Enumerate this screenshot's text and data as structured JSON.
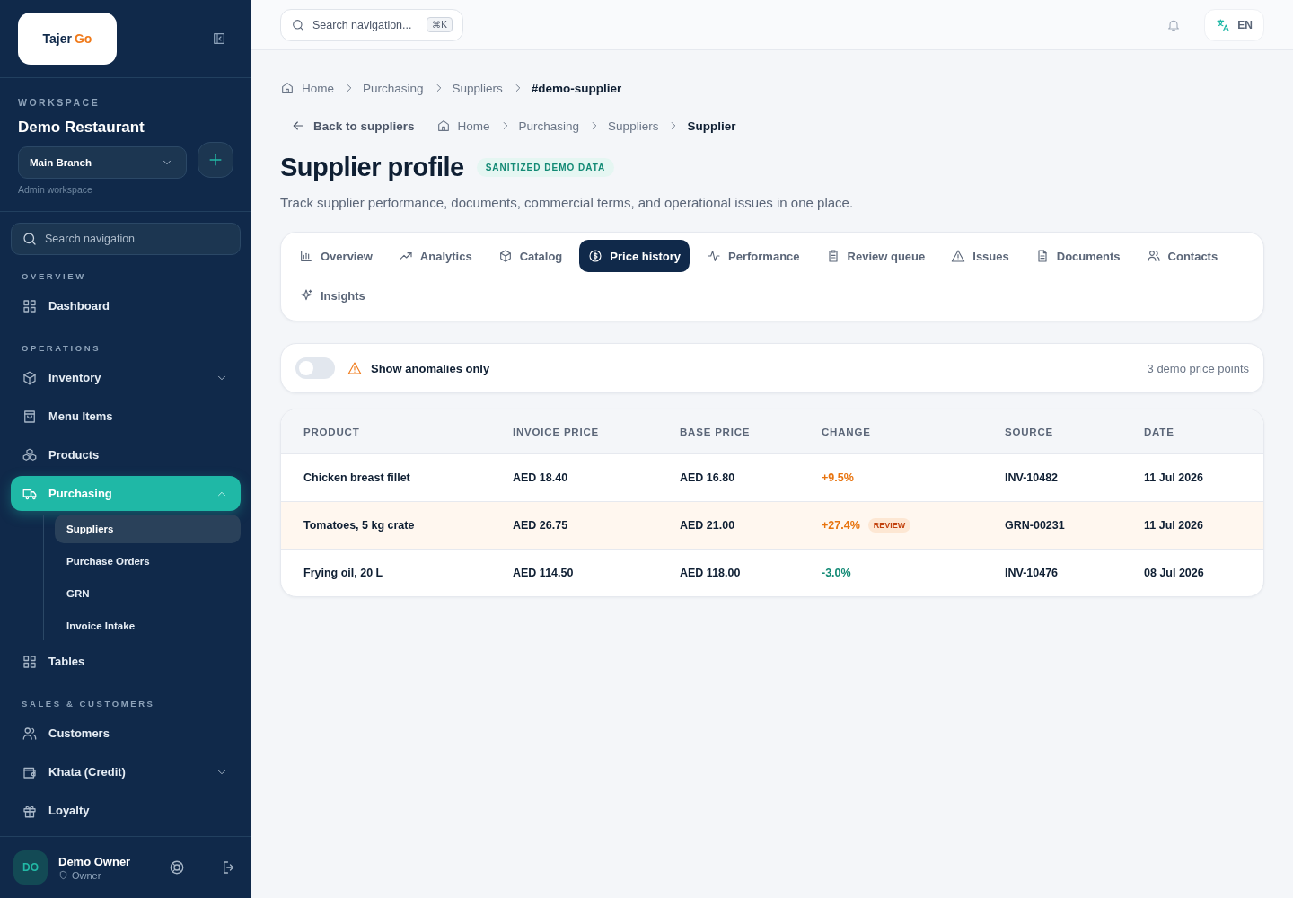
{
  "logo": {
    "primary": "Tajer",
    "accent": "Go"
  },
  "workspace": {
    "label": "WORKSPACE",
    "name": "Demo Restaurant",
    "branch": "Main Branch",
    "caption": "Admin workspace"
  },
  "sidebar_search": {
    "placeholder": "Search navigation"
  },
  "sections": [
    {
      "title": "OVERVIEW",
      "items": [
        {
          "label": "Dashboard",
          "selected": false
        }
      ]
    },
    {
      "title": "OPERATIONS",
      "items": [
        {
          "label": "Inventory",
          "selected": false,
          "expanded": false
        },
        {
          "label": "Menu Items",
          "selected": false
        },
        {
          "label": "Products",
          "selected": false
        },
        {
          "label": "Purchasing",
          "selected": true,
          "expanded": true,
          "children": [
            {
              "label": "Suppliers",
              "selected": true
            },
            {
              "label": "Purchase Orders",
              "selected": false
            },
            {
              "label": "GRN",
              "selected": false
            },
            {
              "label": "Invoice Intake",
              "selected": false
            }
          ]
        },
        {
          "label": "Tables",
          "selected": false
        }
      ]
    },
    {
      "title": "SALES & CUSTOMERS",
      "items": [
        {
          "label": "Customers",
          "selected": false
        },
        {
          "label": "Khata (Credit)",
          "selected": false,
          "expanded": false
        },
        {
          "label": "Loyalty",
          "selected": false
        }
      ]
    }
  ],
  "user": {
    "initials": "DO",
    "name": "Demo Owner",
    "role": "Owner"
  },
  "topbar": {
    "search_placeholder": "Search navigation...",
    "shortcut": "⌘K",
    "language": "EN"
  },
  "breadcrumbs": [
    "Home",
    "Purchasing",
    "Suppliers",
    "#demo-supplier"
  ],
  "back_link": "Back to suppliers",
  "breadcrumbs_2": [
    "Home",
    "Purchasing",
    "Suppliers",
    "Supplier"
  ],
  "title": "Supplier profile",
  "badge": "SANITIZED DEMO DATA",
  "subtitle": "Track supplier performance, documents, commercial terms, and operational issues in one place.",
  "tabs": [
    {
      "label": "Overview",
      "selected": false
    },
    {
      "label": "Analytics",
      "selected": false
    },
    {
      "label": "Catalog",
      "selected": false
    },
    {
      "label": "Price history",
      "selected": true
    },
    {
      "label": "Performance",
      "selected": false
    },
    {
      "label": "Review queue",
      "selected": false
    },
    {
      "label": "Issues",
      "selected": false
    },
    {
      "label": "Documents",
      "selected": false
    },
    {
      "label": "Contacts",
      "selected": false
    },
    {
      "label": "Insights",
      "selected": false
    }
  ],
  "filter": {
    "label": "Show anomalies only",
    "on": false,
    "count": "3 demo price points"
  },
  "table": {
    "columns": [
      "PRODUCT",
      "INVOICE PRICE",
      "BASE PRICE",
      "CHANGE",
      "SOURCE",
      "DATE"
    ],
    "rows": [
      {
        "product": "Chicken breast fillet",
        "invoice_price": "AED 18.40",
        "base_price": "AED 16.80",
        "change": "+9.5%",
        "kind": "increase",
        "flagged": false,
        "source": "INV-10482",
        "date": "11 Jul 2026"
      },
      {
        "product": "Tomatoes, 5 kg crate",
        "invoice_price": "AED 26.75",
        "base_price": "AED 21.00",
        "change": "+27.4%",
        "kind": "increase",
        "flagged": true,
        "flag": "REVIEW",
        "source": "GRN-00231",
        "date": "11 Jul 2026"
      },
      {
        "product": "Frying oil, 20 L",
        "invoice_price": "AED 114.50",
        "base_price": "AED 118.00",
        "change": "-3.0%",
        "kind": "decrease",
        "flagged": false,
        "source": "INV-10476",
        "date": "08 Jul 2026"
      }
    ]
  }
}
